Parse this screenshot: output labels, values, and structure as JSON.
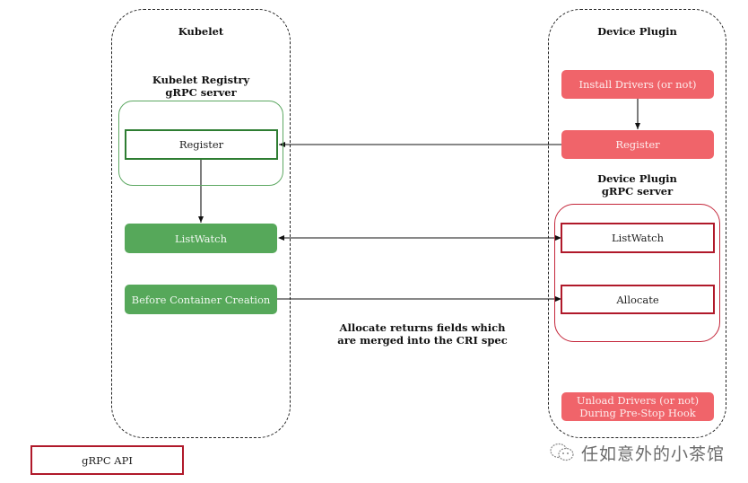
{
  "kubelet": {
    "title": "Kubelet",
    "registry_title": "Kubelet Registry\ngRPC server",
    "registry_line1": "Kubelet Registry",
    "registry_line2": "gRPC server",
    "register": "Register",
    "listwatch": "ListWatch",
    "before_container": "Before Container Creation"
  },
  "device_plugin": {
    "title": "Device Plugin",
    "install_drivers": "Install Drivers (or not)",
    "register": "Register",
    "server_line1": "Device Plugin",
    "server_line2": "gRPC server",
    "listwatch": "ListWatch",
    "allocate": "Allocate",
    "unload_line1": "Unload Drivers (or not)",
    "unload_line2": "During Pre-Stop Hook"
  },
  "annotation": {
    "line1": "Allocate returns fields which",
    "line2": "are merged into the CRI spec"
  },
  "legend": {
    "grpc_api": "gRPC API"
  },
  "watermark": {
    "icon": "wechat-icon",
    "text": "任如意外的小茶馆"
  },
  "colors": {
    "green_fill": "#56a85a",
    "green_outline": "#2e7d32",
    "red_fill": "#f0646a",
    "red_outline": "#b0192a"
  }
}
